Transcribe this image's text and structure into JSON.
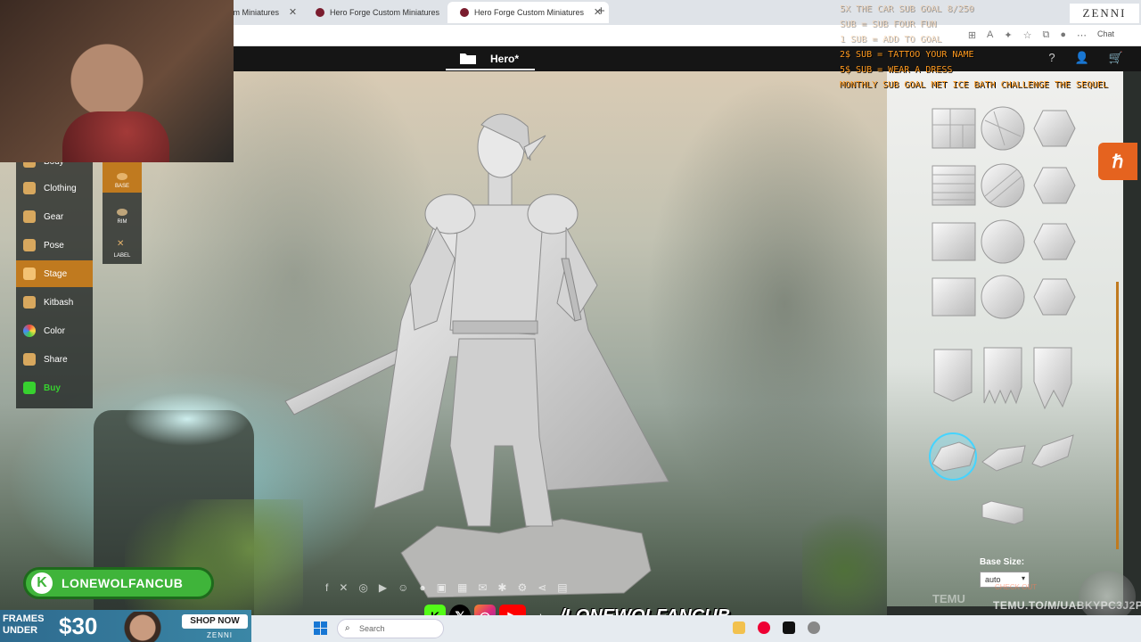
{
  "browser": {
    "tabs": [
      {
        "label": "tom Miniatures"
      },
      {
        "label": "Hero Forge Custom Miniatures"
      },
      {
        "label": "Hero Forge Custom Miniatures"
      }
    ],
    "chat_label": "Chat"
  },
  "site": {
    "doc_title": "Hero*"
  },
  "left_menu": {
    "items": [
      {
        "label": "Body"
      },
      {
        "label": "Clothing"
      },
      {
        "label": "Gear"
      },
      {
        "label": "Pose"
      },
      {
        "label": "Stage"
      },
      {
        "label": "Kitbash"
      },
      {
        "label": "Color"
      },
      {
        "label": "Share"
      },
      {
        "label": "Buy"
      }
    ],
    "active": "Stage"
  },
  "stage_submenu": {
    "items": [
      {
        "label": "BASE"
      },
      {
        "label": "RIM"
      },
      {
        "label": "LABEL"
      }
    ],
    "active": "BASE"
  },
  "base_panel": {
    "base_size_label": "Base Size:",
    "base_size_value": "auto",
    "selected_tile": "rubble-base"
  },
  "overlay": {
    "goals": [
      "5X THE CAR SUB GOAL 8/250",
      "SUB = SUB FOUR FUN",
      "1 SUB = ADD TO GOAL",
      "2$ SUB = TATTOO YOUR NAME",
      "5$ SUB = WEAR A DRESS",
      "MONTHLY SUB GOAL MET ICE BATH CHALLENGE THE SEQUEL"
    ],
    "zenni_logo": "ZENNI",
    "channel_name": "LONEWOLFANCUB",
    "handle": "/LONEWOLFANCUB",
    "ad": {
      "line1": "FRAMES",
      "line2": "UNDER",
      "price": "$30",
      "cta": "SHOP NOW",
      "brand": "ZENNI"
    },
    "temu": {
      "logo": "TEMU",
      "checkout": "CHECK OUT",
      "url": "TEMU.TO/M/UABKYPC3J2P"
    }
  },
  "taskbar": {
    "search_placeholder": "Search"
  },
  "colors": {
    "accent": "#c07a1f",
    "buy": "#37d12f",
    "channel": "#3fb43a",
    "goal_text": "#ff9a1f"
  }
}
